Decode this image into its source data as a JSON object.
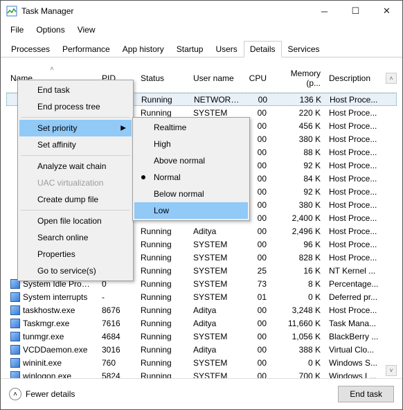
{
  "window": {
    "title": "Task Manager"
  },
  "menubar": {
    "file": "File",
    "options": "Options",
    "view": "View"
  },
  "tabs": {
    "processes": "Processes",
    "performance": "Performance",
    "apphistory": "App history",
    "startup": "Startup",
    "users": "Users",
    "details": "Details",
    "services": "Services"
  },
  "columns": {
    "name": "Name",
    "pid": "PID",
    "status": "Status",
    "user": "User name",
    "cpu": "CPU",
    "mem": "Memory (p...",
    "desc": "Description"
  },
  "rows": [
    {
      "name": "",
      "pid": "",
      "status": "Running",
      "user": "NETWORK...",
      "cpu": "00",
      "mem": "136 K",
      "desc": "Host Proce..."
    },
    {
      "name": "",
      "pid": "",
      "status": "Running",
      "user": "SYSTEM",
      "cpu": "00",
      "mem": "220 K",
      "desc": "Host Proce..."
    },
    {
      "name": "",
      "pid": "",
      "status": "Running",
      "user": "SYSTEM",
      "cpu": "00",
      "mem": "456 K",
      "desc": "Host Proce..."
    },
    {
      "name": "",
      "pid": "",
      "status": "",
      "user": "",
      "cpu": "00",
      "mem": "380 K",
      "desc": "Host Proce..."
    },
    {
      "name": "",
      "pid": "",
      "status": "",
      "user": "",
      "cpu": "00",
      "mem": "88 K",
      "desc": "Host Proce..."
    },
    {
      "name": "",
      "pid": "",
      "status": "",
      "user": "",
      "cpu": "00",
      "mem": "92 K",
      "desc": "Host Proce..."
    },
    {
      "name": "",
      "pid": "",
      "status": "",
      "user": "",
      "cpu": "00",
      "mem": "84 K",
      "desc": "Host Proce..."
    },
    {
      "name": "",
      "pid": "",
      "status": "",
      "user": "",
      "cpu": "00",
      "mem": "92 K",
      "desc": "Host Proce..."
    },
    {
      "name": "",
      "pid": "",
      "status": "",
      "user": "",
      "cpu": "00",
      "mem": "380 K",
      "desc": "Host Proce..."
    },
    {
      "name": "",
      "pid": "",
      "status": "",
      "user": "",
      "cpu": "00",
      "mem": "2,400 K",
      "desc": "Host Proce..."
    },
    {
      "name": "",
      "pid": "",
      "status": "Running",
      "user": "Aditya",
      "cpu": "00",
      "mem": "2,496 K",
      "desc": "Host Proce..."
    },
    {
      "name": "",
      "pid": "",
      "status": "Running",
      "user": "SYSTEM",
      "cpu": "00",
      "mem": "96 K",
      "desc": "Host Proce..."
    },
    {
      "name": "",
      "pid": "",
      "status": "Running",
      "user": "SYSTEM",
      "cpu": "00",
      "mem": "828 K",
      "desc": "Host Proce..."
    },
    {
      "name": "",
      "pid": "",
      "status": "Running",
      "user": "SYSTEM",
      "cpu": "25",
      "mem": "16 K",
      "desc": "NT Kernel ..."
    },
    {
      "name": "System Idle Process",
      "pid": "0",
      "status": "Running",
      "user": "SYSTEM",
      "cpu": "73",
      "mem": "8 K",
      "desc": "Percentage..."
    },
    {
      "name": "System interrupts",
      "pid": "-",
      "status": "Running",
      "user": "SYSTEM",
      "cpu": "01",
      "mem": "0 K",
      "desc": "Deferred pr..."
    },
    {
      "name": "taskhostw.exe",
      "pid": "8676",
      "status": "Running",
      "user": "Aditya",
      "cpu": "00",
      "mem": "3,248 K",
      "desc": "Host Proce..."
    },
    {
      "name": "Taskmgr.exe",
      "pid": "7616",
      "status": "Running",
      "user": "Aditya",
      "cpu": "00",
      "mem": "11,660 K",
      "desc": "Task Mana..."
    },
    {
      "name": "tunmgr.exe",
      "pid": "4684",
      "status": "Running",
      "user": "SYSTEM",
      "cpu": "00",
      "mem": "1,056 K",
      "desc": "BlackBerry ..."
    },
    {
      "name": "VCDDaemon.exe",
      "pid": "3016",
      "status": "Running",
      "user": "Aditya",
      "cpu": "00",
      "mem": "388 K",
      "desc": "Virtual Clo..."
    },
    {
      "name": "wininit.exe",
      "pid": "760",
      "status": "Running",
      "user": "SYSTEM",
      "cpu": "00",
      "mem": "0 K",
      "desc": "Windows S..."
    },
    {
      "name": "winlogon.exe",
      "pid": "5824",
      "status": "Running",
      "user": "SYSTEM",
      "cpu": "00",
      "mem": "700 K",
      "desc": "Windows L..."
    }
  ],
  "contextmenu": {
    "endtask": "End task",
    "endtree": "End process tree",
    "setpriority": "Set priority",
    "setaffinity": "Set affinity",
    "analyze": "Analyze wait chain",
    "uacvirt": "UAC virtualization",
    "dump": "Create dump file",
    "openloc": "Open file location",
    "search": "Search online",
    "properties": "Properties",
    "services": "Go to service(s)"
  },
  "priority_submenu": {
    "realtime": "Realtime",
    "high": "High",
    "abovenormal": "Above normal",
    "normal": "Normal",
    "belownormal": "Below normal",
    "low": "Low"
  },
  "footer": {
    "fewer": "Fewer details",
    "endtask": "End task"
  }
}
